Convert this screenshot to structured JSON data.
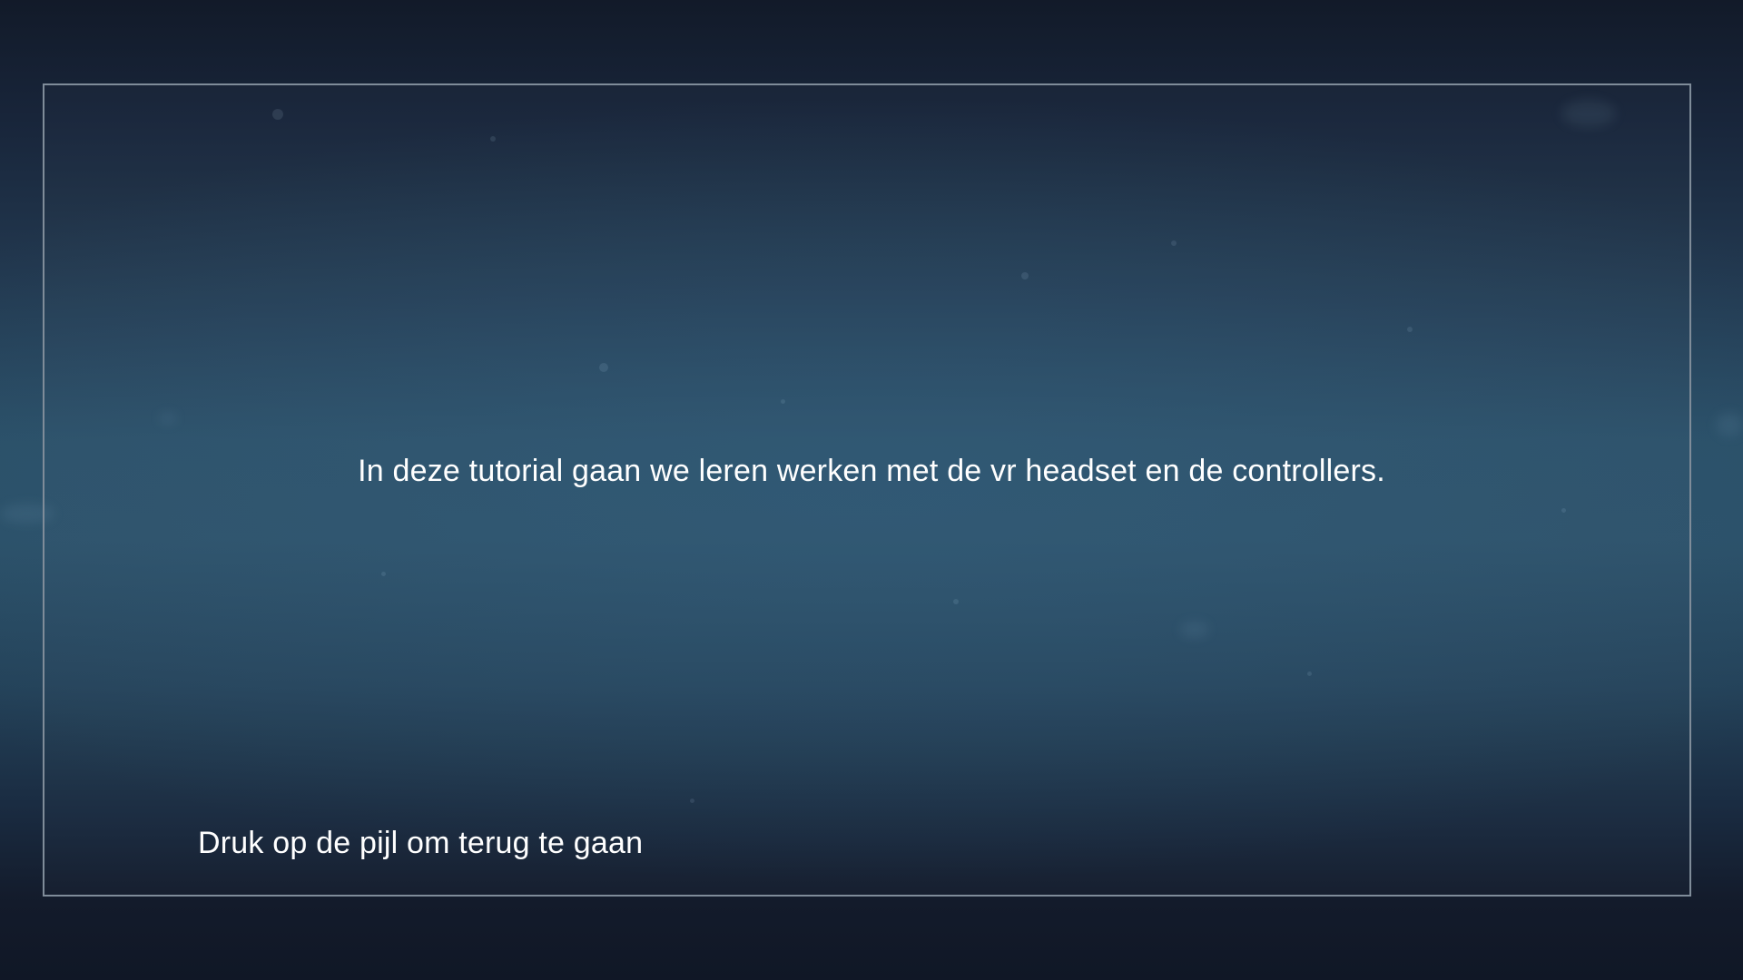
{
  "tutorial": {
    "intro_text": "In deze tutorial gaan we leren werken met de vr headset en de controllers.",
    "back_hint": "Druk op de pijl om terug te gaan"
  },
  "colors": {
    "text": "#ffffff",
    "frame_border": "#7f8c99",
    "background_dark": "#101726",
    "background_mid": "#2b5068"
  }
}
